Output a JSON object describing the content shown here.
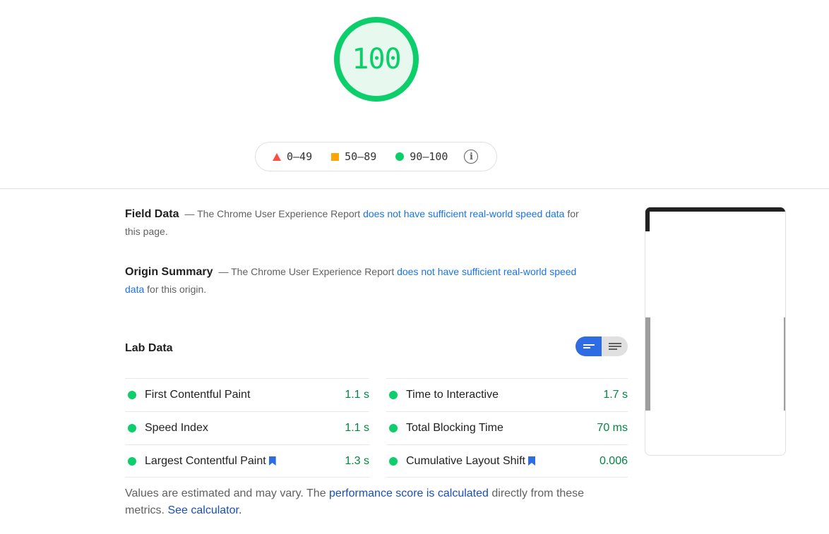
{
  "score": {
    "value": "100",
    "color": "#0cce6b",
    "fill": "#e7f8ee"
  },
  "legend": {
    "items": [
      {
        "icon": "triangle-icon",
        "color": "#ff4e42",
        "label": "0–49"
      },
      {
        "icon": "square-icon",
        "color": "#ffa400",
        "label": "50–89"
      },
      {
        "icon": "circle-icon",
        "color": "#0cce6b",
        "label": "90–100"
      }
    ],
    "info_icon": "i"
  },
  "field_data": {
    "title": "Field Data",
    "prefix": "— The Chrome User Experience Report ",
    "link": "does not have sufficient real-world speed data",
    "suffix": " for this page."
  },
  "origin_summary": {
    "title": "Origin Summary",
    "prefix": "— The Chrome User Experience Report ",
    "link": "does not have sufficient real-world speed data",
    "suffix": " for this origin."
  },
  "lab_data": {
    "title": "Lab Data",
    "metrics": [
      {
        "label": "First Contentful Paint",
        "value": "1.1 s",
        "bookmark": false
      },
      {
        "label": "Time to Interactive",
        "value": "1.7 s",
        "bookmark": false
      },
      {
        "label": "Speed Index",
        "value": "1.1 s",
        "bookmark": false
      },
      {
        "label": "Total Blocking Time",
        "value": "70 ms",
        "bookmark": false
      },
      {
        "label": "Largest Contentful Paint",
        "value": "1.3 s",
        "bookmark": true
      },
      {
        "label": "Cumulative Layout Shift",
        "value": "0.006",
        "bookmark": true
      }
    ]
  },
  "note": {
    "prefix": "Values are estimated and may vary. The ",
    "link1": "performance score is calculated",
    "middle": " directly from these metrics. ",
    "link2": "See calculator."
  },
  "colors": {
    "pass": "#0cce6b",
    "pass_text": "#018642",
    "link": "#1a73e8",
    "toggle_on": "#2f6be3"
  }
}
